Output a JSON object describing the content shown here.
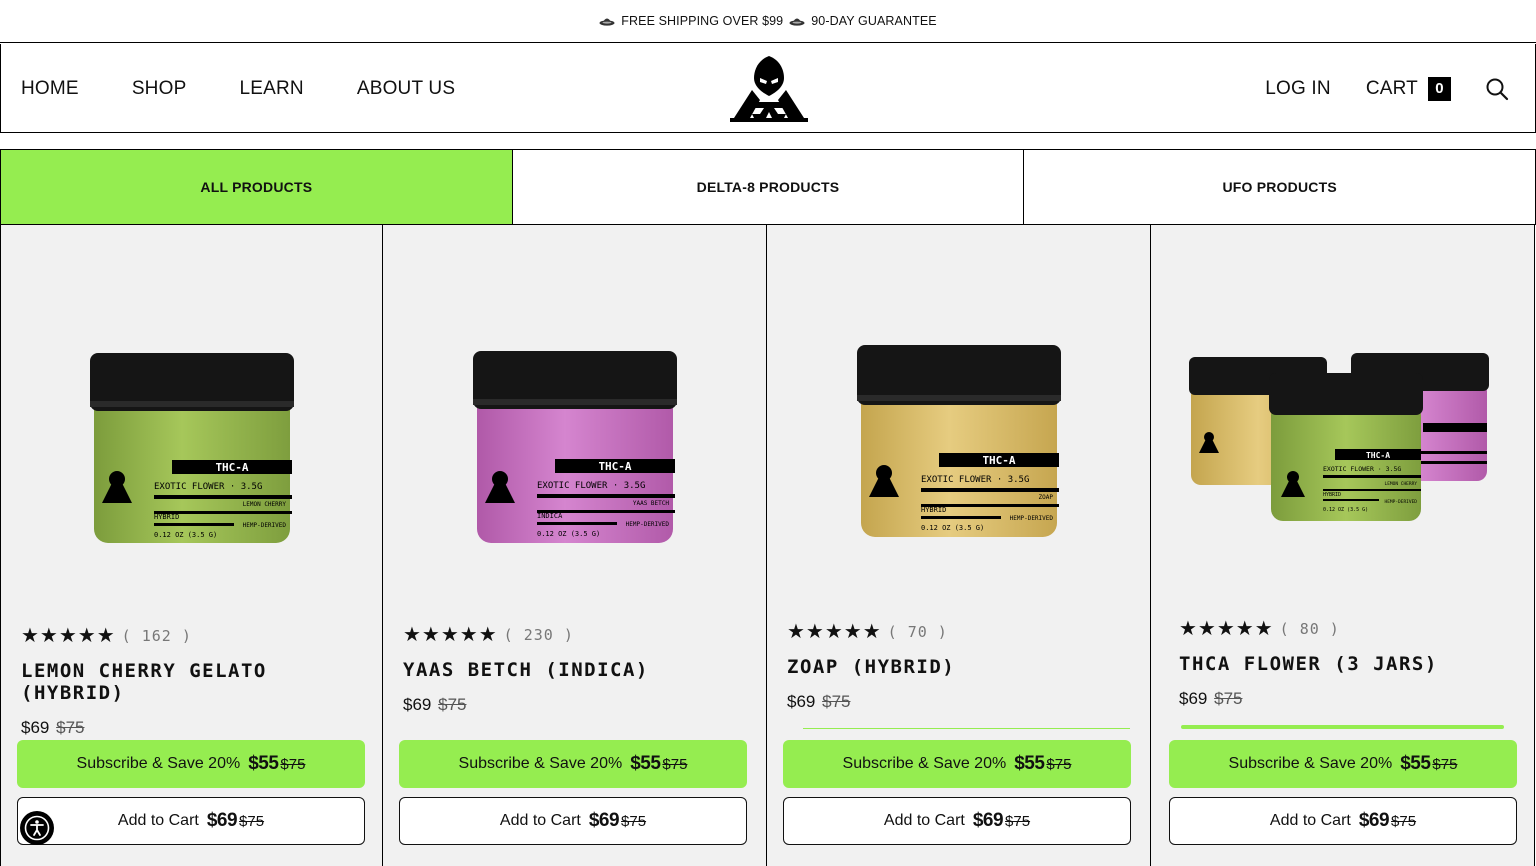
{
  "announcement": {
    "text1": "FREE SHIPPING OVER $99",
    "text2": "90-DAY GUARANTEE"
  },
  "nav": {
    "left": [
      "HOME",
      "SHOP",
      "LEARN",
      "ABOUT US"
    ],
    "login": "LOG IN",
    "cart_label": "CART",
    "cart_count": "0"
  },
  "tabs": [
    {
      "label": "ALL PRODUCTS",
      "active": true
    },
    {
      "label": "DELTA-8 PRODUCTS",
      "active": false
    },
    {
      "label": "UFO PRODUCTS",
      "active": false
    }
  ],
  "colors": {
    "accent": "#95ed50",
    "card_bg": "#f1f1f1",
    "jar_green": "#93b548",
    "jar_pink": "#c86ec0",
    "jar_gold": "#d9bb64"
  },
  "products": [
    {
      "stars": "★★★★★",
      "reviews": "( 162 )",
      "title": "LEMON CHERRY GELATO (HYBRID)",
      "price": "$69",
      "old_price": "$75",
      "subscribe_label": "Subscribe & Save 20%",
      "subscribe_price": "$55",
      "subscribe_old": "$75",
      "add_label": "Add to Cart",
      "add_price": "$69",
      "add_old": "$75",
      "jar": {
        "label_brand": "THC-A",
        "label_line": "EXOTIC FLOWER · 3.5G",
        "strain": "LEMON CHERRY",
        "type": "HYBRID",
        "derived": "HEMP-DERIVED",
        "weight": "0.12 OZ (3.5 G)"
      }
    },
    {
      "stars": "★★★★★",
      "reviews": "( 230 )",
      "title": "YAAS BETCH (INDICA)",
      "price": "$69",
      "old_price": "$75",
      "subscribe_label": "Subscribe & Save 20%",
      "subscribe_price": "$55",
      "subscribe_old": "$75",
      "add_label": "Add to Cart",
      "add_price": "$69",
      "add_old": "$75",
      "jar": {
        "label_brand": "THC-A",
        "label_line": "EXOTIC FLOWER · 3.5G",
        "strain": "YAAS BETCH",
        "type": "INDICA",
        "derived": "HEMP-DERIVED",
        "weight": "0.12 OZ (3.5 G)"
      }
    },
    {
      "stars": "★★★★★",
      "reviews": "( 70 )",
      "title": "ZOAP (HYBRID)",
      "price": "$69",
      "old_price": "$75",
      "subscribe_label": "Subscribe & Save 20%",
      "subscribe_price": "$55",
      "subscribe_old": "$75",
      "add_label": "Add to Cart",
      "add_price": "$69",
      "add_old": "$75",
      "jar": {
        "label_brand": "THC-A",
        "label_line": "EXOTIC FLOWER · 3.5G",
        "strain": "ZOAP",
        "type": "HYBRID",
        "derived": "HEMP-DERIVED",
        "weight": "0.12 OZ (3.5 G)"
      }
    },
    {
      "stars": "★★★★★",
      "reviews": "( 80 )",
      "title": "THCA FLOWER (3 JARS)",
      "price": "$69",
      "old_price": "$75",
      "subscribe_label": "Subscribe & Save 20%",
      "subscribe_price": "$55",
      "subscribe_old": "$75",
      "add_label": "Add to Cart",
      "add_price": "$69",
      "add_old": "$75",
      "jar": {
        "label_brand": "THC-A",
        "label_line": "EXOTIC FLOWER · 3.5G",
        "strain": "LEMON CHERRY",
        "type": "HYBRID",
        "derived": "HEMP-DERIVED",
        "weight": "0.12 OZ (3.5 G)"
      }
    }
  ]
}
